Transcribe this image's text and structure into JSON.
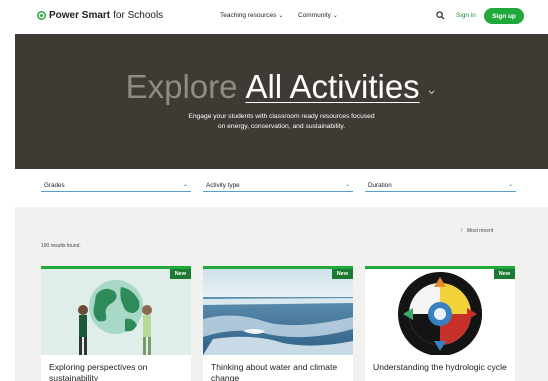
{
  "header": {
    "logo_strong": "Power Smart",
    "logo_light": "for Schools",
    "nav": [
      {
        "label": "Teaching resources"
      },
      {
        "label": "Community"
      }
    ],
    "sign_in": "Sign in",
    "sign_up": "Sign up",
    "icons": {
      "search": "search-icon",
      "logo": "logo-mark-icon",
      "chevron": "chevron-down-icon"
    }
  },
  "hero": {
    "title_prefix": "Explore",
    "title_selection": "All Activities",
    "subtitle_line1": "Engage your students with classroom ready resources focused",
    "subtitle_line2": "on energy, conservation, and sustainability."
  },
  "filters": [
    {
      "label": "Grades"
    },
    {
      "label": "Activity type"
    },
    {
      "label": "Duration"
    }
  ],
  "results": {
    "count_text": "190 results found.",
    "sort_label": "Most recent"
  },
  "cards": [
    {
      "badge": "New",
      "title": "Exploring perspectives on sustainability",
      "image": "globe-illustration"
    },
    {
      "badge": "New",
      "title": "Thinking about water and climate change",
      "image": "icy-water-photo"
    },
    {
      "badge": "New",
      "title": "Understanding the hydrologic cycle",
      "image": "medicine-wheel-illustration"
    }
  ],
  "colors": {
    "brand_green": "#20a83a",
    "badge_green": "#1d7a34",
    "hero_bg": "#3f3a34",
    "filter_underline": "#5aa0c8",
    "results_bg": "#f1f1f0"
  }
}
